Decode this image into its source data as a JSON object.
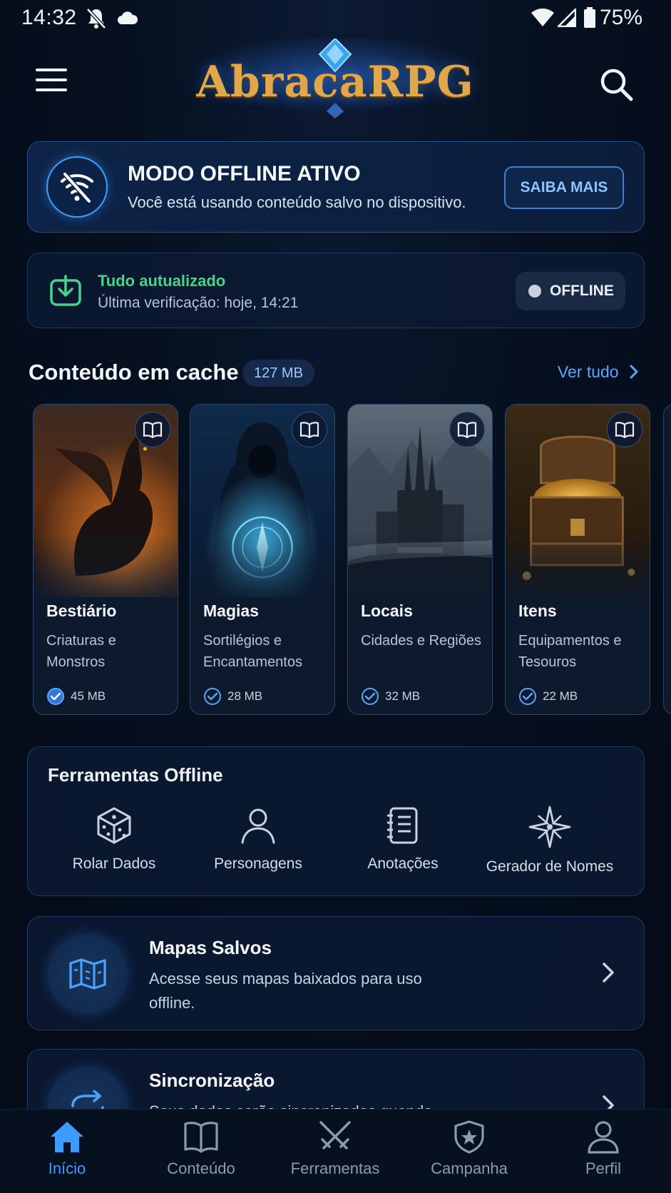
{
  "status_bar": {
    "time": "14:32",
    "battery": "75%",
    "icons": [
      "bell-off-icon",
      "cloud-icon",
      "wifi-icon",
      "cell-signal-icon",
      "battery-icon"
    ]
  },
  "header": {
    "logo_text": "AbracaRPG",
    "menu_icon": "hamburger-menu-icon",
    "search_icon": "search-icon"
  },
  "offline_banner": {
    "title": "MODO OFFLINE ATIVO",
    "subtitle": "Você está usando conteúdo salvo no dispositivo.",
    "button": "SAIBA MAIS",
    "icon": "wifi-off-icon"
  },
  "update_status": {
    "title": "Tudo autualizado",
    "subtitle": "Última verificação: hoje, 14:21",
    "pill_label": "OFFLINE",
    "icon": "download-check-icon"
  },
  "cache_section": {
    "title": "Conteúdo em cache",
    "size_badge": "127 MB",
    "see_all": "Ver tudo",
    "items": [
      {
        "title": "Bestiário",
        "subtitle": "Criaturas e Monstros",
        "size": "45 MB",
        "art": "dragon"
      },
      {
        "title": "Magias",
        "subtitle": "Sortilégios e Encantamentos",
        "size": "28 MB",
        "art": "hooded-mage"
      },
      {
        "title": "Locais",
        "subtitle": "Cidades e Regiões",
        "size": "32 MB",
        "art": "castle"
      },
      {
        "title": "Itens",
        "subtitle": "Equipamentos e Tesouros",
        "size": "22 MB",
        "art": "treasure-chest"
      }
    ]
  },
  "tools": {
    "title": "Ferramentas Offline",
    "items": [
      {
        "label": "Rolar Dados",
        "icon": "dice-icon"
      },
      {
        "label": "Personagens",
        "icon": "person-icon"
      },
      {
        "label": "Anotações",
        "icon": "notebook-icon"
      },
      {
        "label": "Gerador de Nomes",
        "icon": "compass-star-icon"
      }
    ]
  },
  "maps": {
    "title": "Mapas Salvos",
    "subtitle": "Acesse seus mapas baixados para uso offline.",
    "icon": "map-icon"
  },
  "sync": {
    "title": "Sincronização",
    "subtitle": "Seus dados serão sincronizados quando",
    "icon": "sync-arrows-icon"
  },
  "bottom_nav": [
    {
      "label": "Início",
      "icon": "home-icon",
      "active": true
    },
    {
      "label": "Conteúdo",
      "icon": "book-icon",
      "active": false
    },
    {
      "label": "Ferramentas",
      "icon": "crossed-swords-icon",
      "active": false
    },
    {
      "label": "Campanha",
      "icon": "shield-icon",
      "active": false
    },
    {
      "label": "Perfil",
      "icon": "profile-icon",
      "active": false
    }
  ],
  "colors": {
    "accent": "#3d9bff",
    "success": "#46d38a",
    "logo_gold": "#e0a84a",
    "background": "#06101f"
  }
}
